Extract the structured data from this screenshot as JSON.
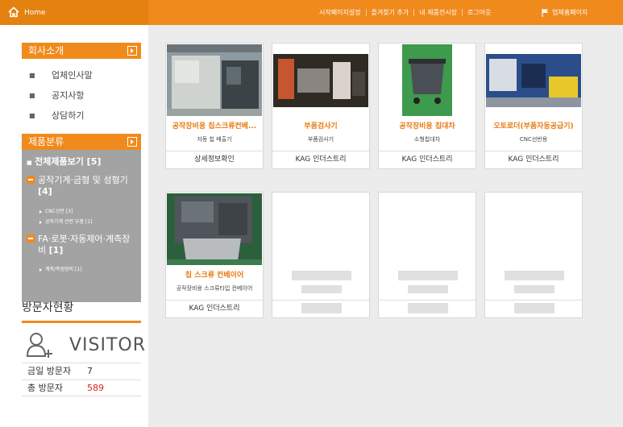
{
  "topbar": {
    "home_label": "Home",
    "nav": [
      "시작페이지설정",
      "즐겨찾기 추가",
      "내 제품전시장",
      "로그아웃"
    ],
    "corp_link": "업체홈페이지"
  },
  "sidebar": {
    "company_header": "회사소개",
    "company_items": [
      "업체인사말",
      "공지사항",
      "상담하기"
    ],
    "category_header": "제품분류",
    "all_products": "전체제품보기 [5]",
    "cat1": {
      "label": "공작기계·금형 및 성형기",
      "count": "[4]",
      "subs": [
        "CNC선반 [3]",
        "공작기계 관련 부품 [1]"
      ]
    },
    "cat2": {
      "label": "FA·로봇·자동제어·계측장",
      "label2": "비",
      "count": "[1]",
      "subs": [
        "계측/측정장비 [1]"
      ]
    }
  },
  "visitor": {
    "title": "방문자현황",
    "word": "VISITOR",
    "today_label": "금일 방문자",
    "today_value": "7",
    "total_label": "총 방문자",
    "total_value": "589"
  },
  "products": [
    {
      "title": "공작장비용 칩스크류컨베...",
      "sub": "자동 칩 배출기",
      "foot": "상세정보확인"
    },
    {
      "title": "부품검사기",
      "sub": "부품검사기",
      "foot": "KAG 인더스트리"
    },
    {
      "title": "공작장비용 칩대차",
      "sub": "소형칩대차",
      "foot": "KAG 인더스트리"
    },
    {
      "title": "오토로더(부품자동공급기)",
      "sub": "CNC선반용",
      "foot": "KAG 인더스트리"
    },
    {
      "title": "칩 스크류 컨베이어",
      "sub": "공작장비용 스크류타입 컨베이어",
      "foot": "KAG 인더스트리"
    }
  ],
  "colors": {
    "accent": "#f08a1c",
    "category_bg": "#a3a3a3",
    "title_orange": "#e87a12",
    "count_red": "#d9251d"
  }
}
